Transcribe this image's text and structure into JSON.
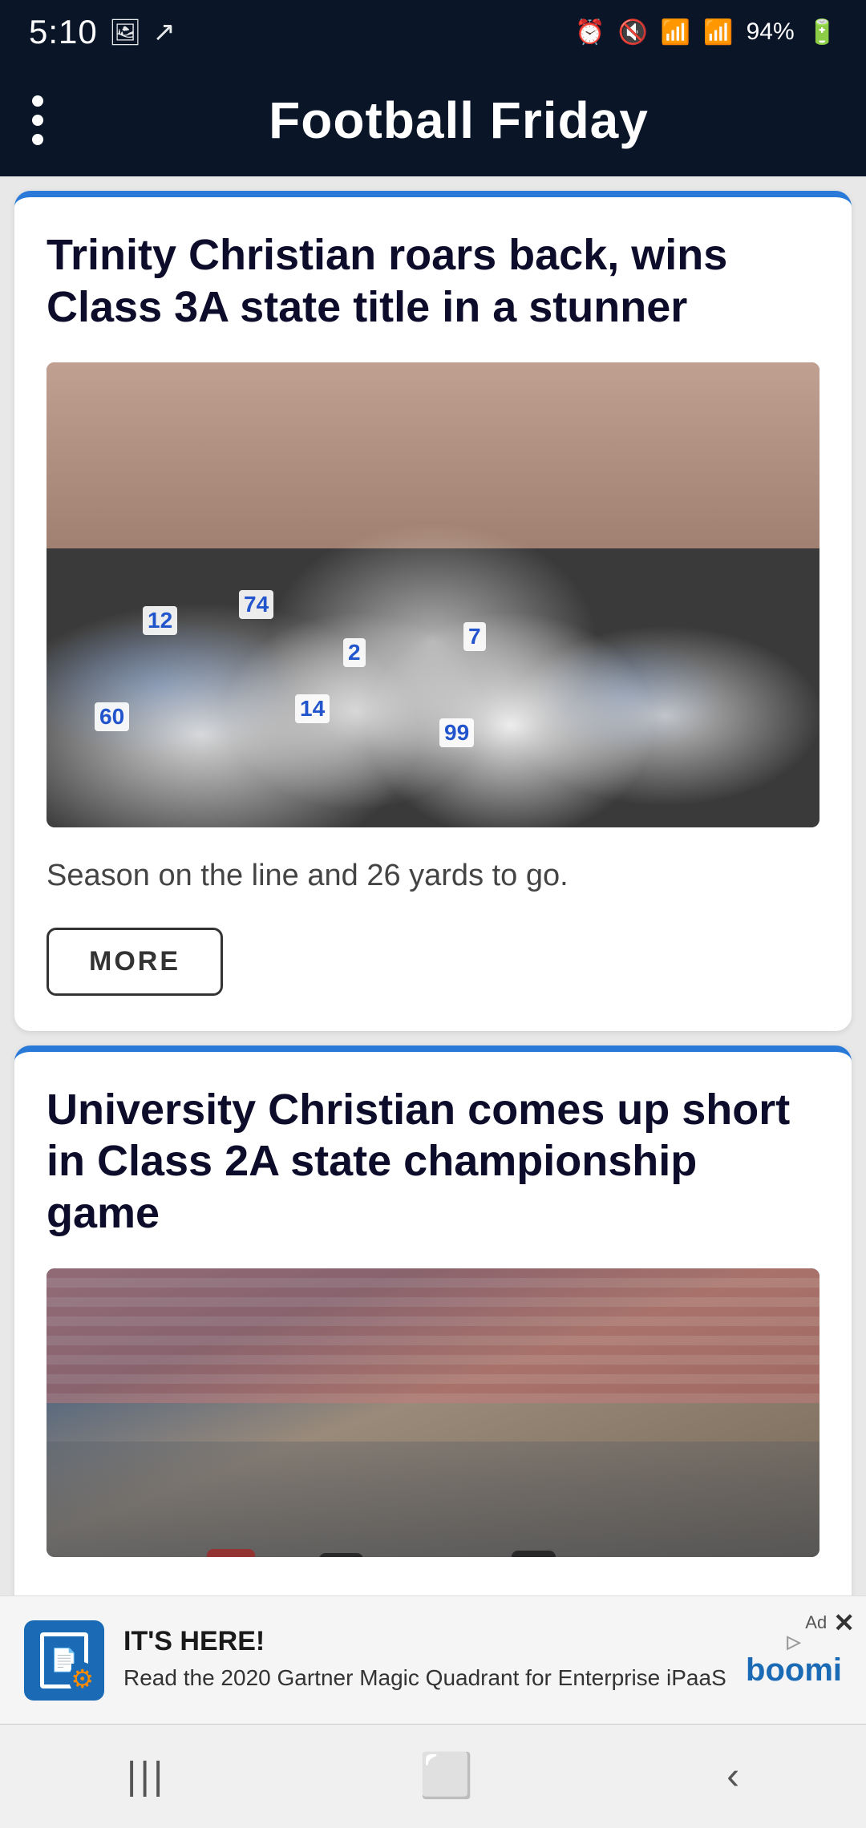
{
  "statusBar": {
    "time": "5:10",
    "battery": "94%",
    "icons": {
      "gallery": "🖼",
      "screenshot": "↗",
      "alarm": "⏰",
      "mute": "🔇",
      "wifi": "📶",
      "signal": "📶"
    }
  },
  "toolbar": {
    "title": "Football Friday",
    "menuLabel": "Menu"
  },
  "articles": [
    {
      "id": "article-1",
      "title": "Trinity Christian roars back, wins Class 3A state title in a stunner",
      "summary": "Season on the line and 26 yards to go.",
      "moreLabel": "MORE",
      "imageAlt": "Trinity Christian football team celebrating state title"
    },
    {
      "id": "article-2",
      "title": "University Christian comes up short in Class 2A state championship game",
      "summary": "",
      "imageAlt": "University Christian football game action"
    }
  ],
  "ad": {
    "headline": "IT'S HERE!",
    "subtext": "Read the 2020 Gartner Magic Quadrant for Enterprise iPaaS",
    "logo": "boomi",
    "logoTagline": "▷",
    "closeLabel": "✕"
  },
  "bottomNav": {
    "recentLabel": "|||",
    "homeLabel": "⬜",
    "backLabel": "<"
  }
}
